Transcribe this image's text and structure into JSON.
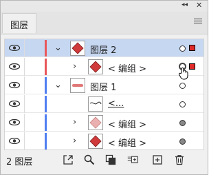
{
  "window": {
    "collapse_icon": "double-chevron-icon",
    "close_icon": "close-icon"
  },
  "tab": {
    "label": "图层"
  },
  "menu_icon": "hamburger-icon",
  "colors": {
    "selected_row": "#c6d7f2",
    "red_layer": "#e8575a",
    "blue_layer": "#4f7ef0",
    "selected_square": "#e02a2a"
  },
  "layers": [
    {
      "label": "图层 2",
      "expanded": true,
      "selected": true,
      "color": "red",
      "target": "empty",
      "has_selected_art": true
    },
    {
      "label": "< 编组 >",
      "expanded": false,
      "selected": false,
      "color": "red",
      "target": "ring",
      "has_selected_art": true
    },
    {
      "label": "图层 1",
      "expanded": true,
      "selected": false,
      "color": "blue",
      "target": "empty",
      "has_selected_art": false
    },
    {
      "label": "<...",
      "expanded": null,
      "selected": false,
      "color": "blue",
      "target": "empty",
      "has_selected_art": false
    },
    {
      "label": "< 编组 >",
      "expanded": false,
      "selected": false,
      "color": "blue",
      "target": "filled",
      "has_selected_art": false
    },
    {
      "label": "< 编组 >",
      "expanded": false,
      "selected": false,
      "color": "blue",
      "target": "filled",
      "has_selected_art": false
    }
  ],
  "status": {
    "text": "2 图层"
  },
  "toolbar": [
    "export-icon",
    "search-icon",
    "clipping-mask-icon",
    "new-sublayer-icon",
    "new-layer-icon",
    "trash-icon"
  ]
}
